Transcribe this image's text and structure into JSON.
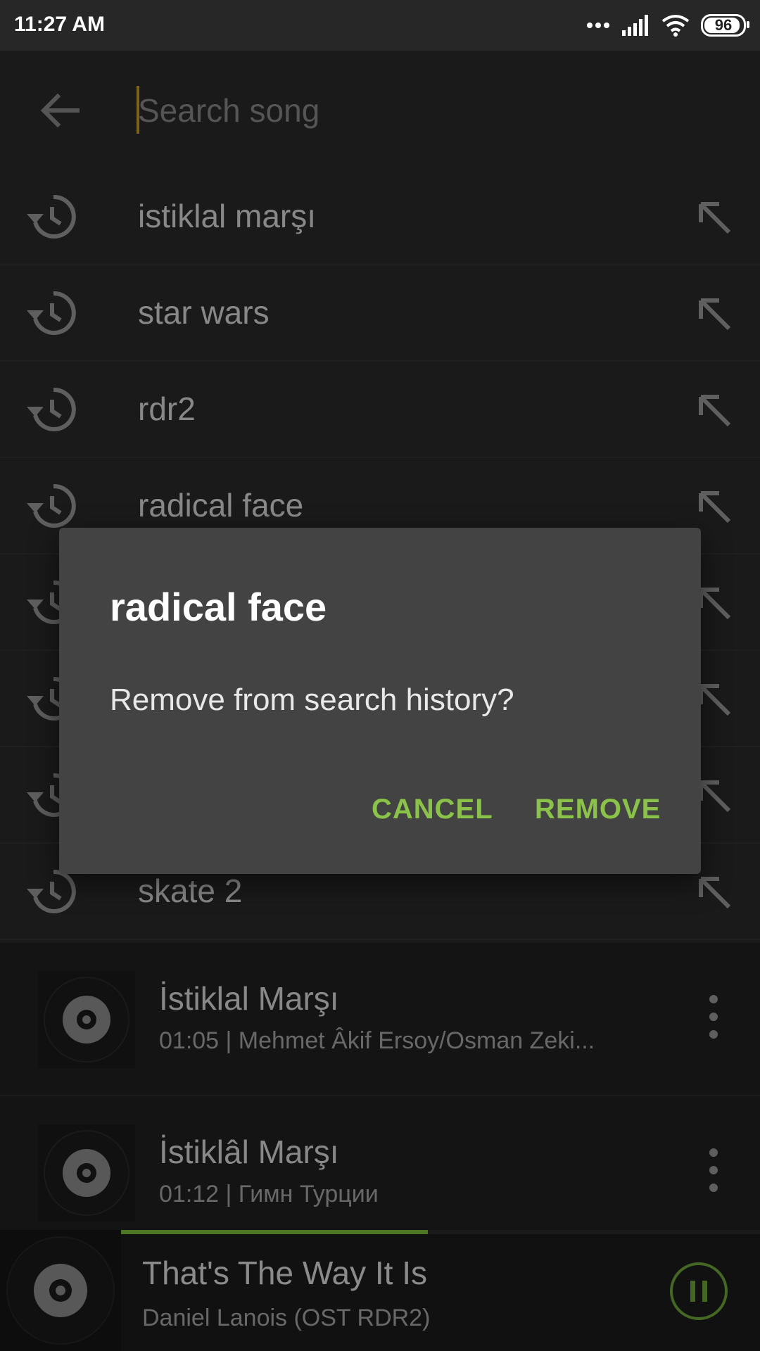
{
  "status_bar": {
    "time": "11:27 AM",
    "battery": "96"
  },
  "search": {
    "placeholder": "Search song",
    "value": ""
  },
  "history": [
    {
      "label": "istiklal marşı"
    },
    {
      "label": "star wars"
    },
    {
      "label": "rdr2"
    },
    {
      "label": "radical face"
    },
    {
      "label": ""
    },
    {
      "label": ""
    },
    {
      "label": ""
    },
    {
      "label": "skate 2"
    }
  ],
  "songs": [
    {
      "title": "İstiklal Marşı",
      "subtitle": "01:05  |  Mehmet Âkif Ersoy/Osman Zeki..."
    },
    {
      "title": "İstiklâl Marşı",
      "subtitle": "01:12  |  Гимн Турции"
    }
  ],
  "now_playing": {
    "title": "That's The Way It Is",
    "artist": "Daniel Lanois (OST RDR2)",
    "progress": 0.48
  },
  "dialog": {
    "title": "radical face",
    "message": "Remove from search history?",
    "cancel_label": "CANCEL",
    "remove_label": "REMOVE"
  },
  "colors": {
    "accent": "#8bc34a",
    "caret": "#c8a42c",
    "dialog_bg": "#434343"
  }
}
